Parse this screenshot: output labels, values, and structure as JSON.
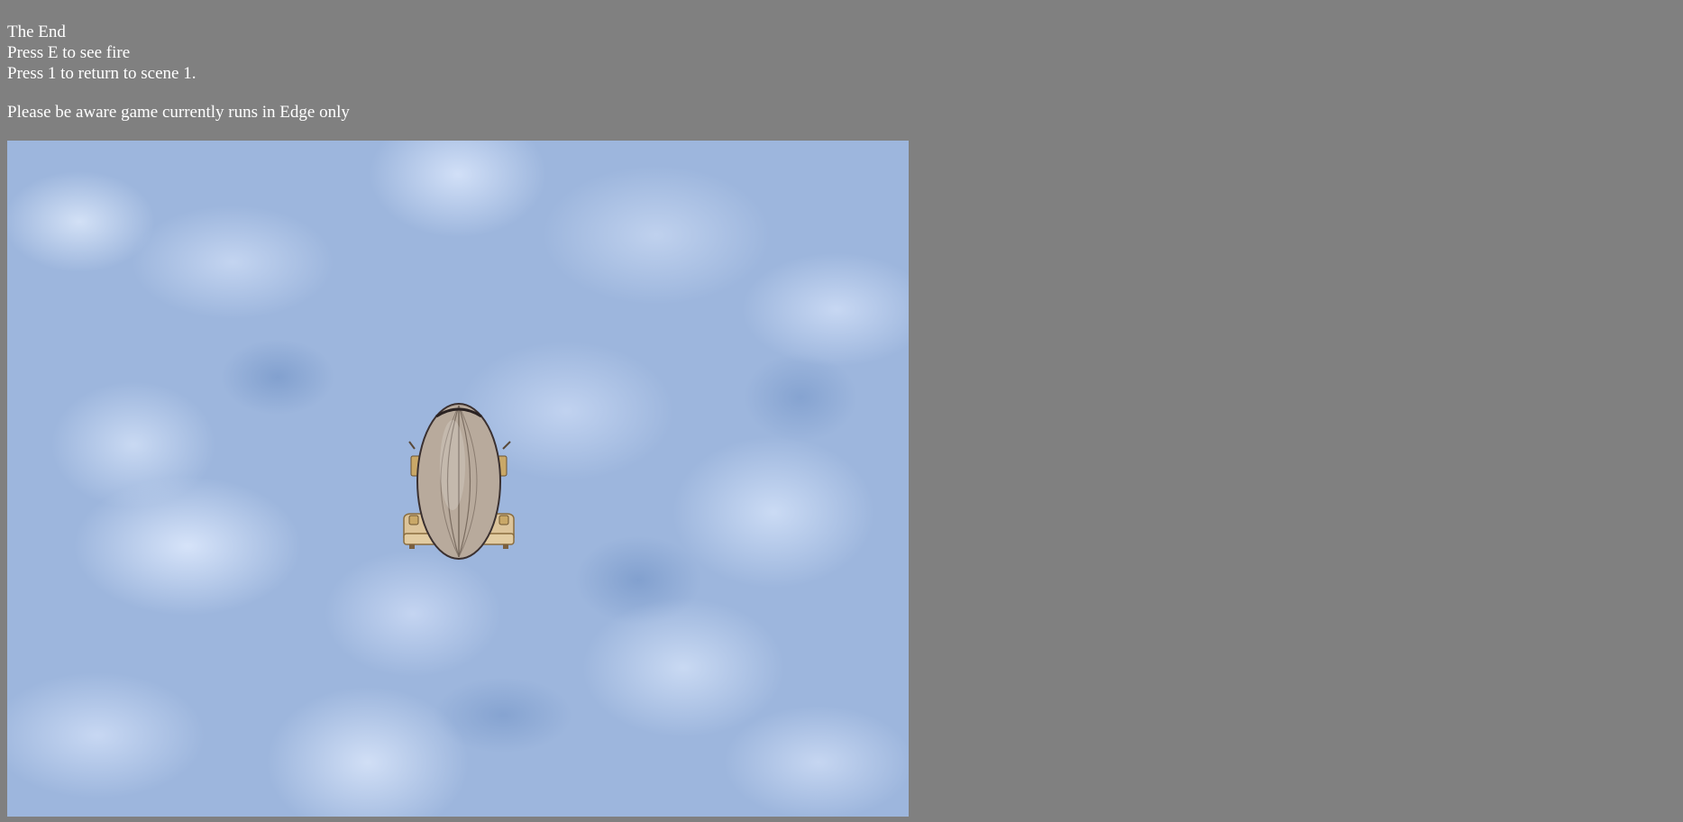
{
  "info": {
    "line1": "The End",
    "line2": "Press E to see fire",
    "line3": "Press 1 to return to scene 1."
  },
  "notice": "Please be aware game currently runs in Edge only",
  "game": {
    "background": "sky-clouds",
    "sprite": "airship"
  },
  "colors": {
    "page_background": "#808080",
    "text": "#ffffff",
    "sky": "#9db6dd",
    "balloon": "#b8aa9c",
    "gondola": "#d8bf8f"
  }
}
